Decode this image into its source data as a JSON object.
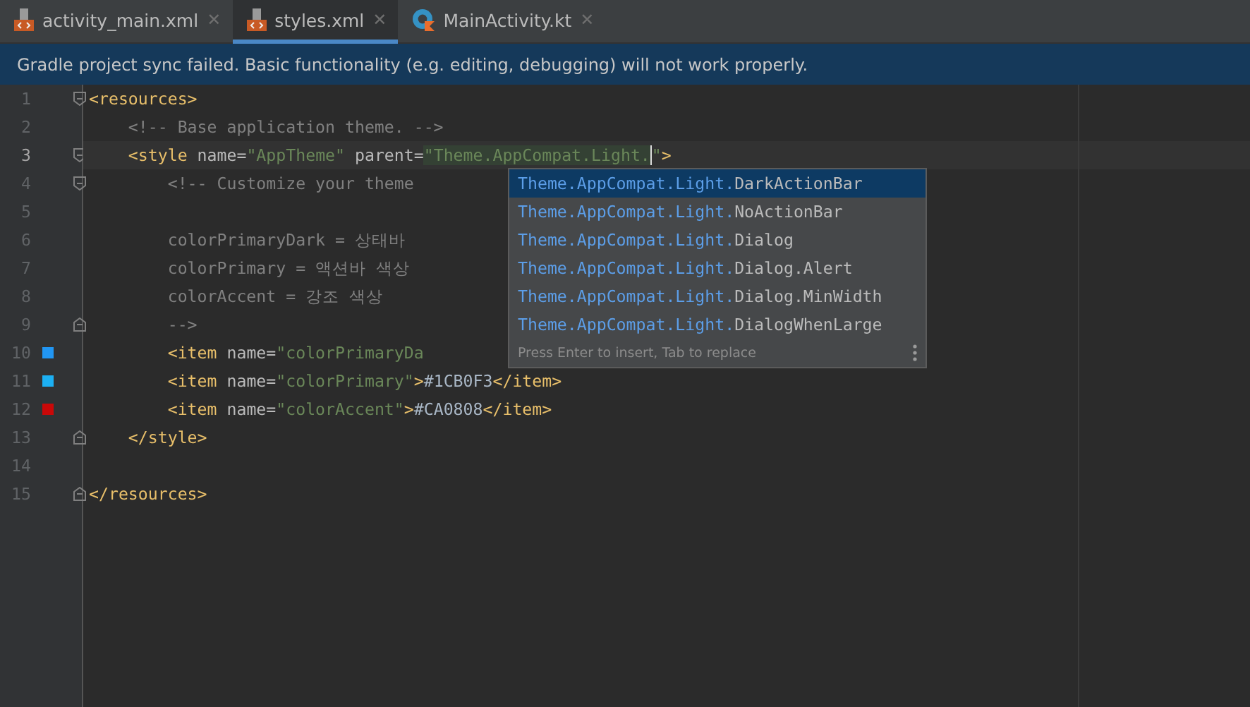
{
  "tabs": [
    {
      "label": "activity_main.xml",
      "kind": "xml",
      "close": "✕",
      "selected": false
    },
    {
      "label": "styles.xml",
      "kind": "xml",
      "close": "✕",
      "selected": true
    },
    {
      "label": "MainActivity.kt",
      "kind": "kotlin",
      "close": "✕",
      "selected": false
    }
  ],
  "banner": "Gradle project sync failed. Basic functionality (e.g. editing, debugging) will not work properly.",
  "lines": [
    {
      "number": "1",
      "kind": "opener",
      "tokens": [
        {
          "kind": "tag",
          "text": "<resources>"
        }
      ]
    },
    {
      "number": "2",
      "kind": "plain",
      "tokens": [
        {
          "kind": "comment",
          "text": "    <!-- Base application theme. -->"
        }
      ]
    },
    {
      "number": "3",
      "kind": "opener",
      "current": true,
      "tokens": [
        {
          "kind": "tag",
          "text": "    <style"
        },
        {
          "kind": "attr",
          "text": " name="
        },
        {
          "kind": "value",
          "text": "\"AppTheme\""
        },
        {
          "kind": "attr",
          "text": " parent="
        },
        {
          "kind": "edit",
          "text": "\"Theme.AppCompat.Light."
        },
        {
          "kind": "value",
          "text": "\""
        },
        {
          "kind": "tag",
          "text": ">"
        }
      ]
    },
    {
      "number": "4",
      "kind": "opener",
      "tokens": [
        {
          "kind": "comment",
          "text": "        <!-- Customize your theme"
        }
      ]
    },
    {
      "number": "5",
      "kind": "plain"
    },
    {
      "number": "6",
      "kind": "plain",
      "tokens": [
        {
          "kind": "comment",
          "text": "        colorPrimaryDark = 상태바"
        }
      ]
    },
    {
      "number": "7",
      "kind": "plain",
      "tokens": [
        {
          "kind": "comment",
          "text": "        colorPrimary = 액션바 색상"
        }
      ]
    },
    {
      "number": "8",
      "kind": "plain",
      "tokens": [
        {
          "kind": "comment",
          "text": "        colorAccent = 강조 색상"
        }
      ]
    },
    {
      "number": "9",
      "kind": "closer",
      "tokens": [
        {
          "kind": "comment",
          "text": "        -->"
        }
      ]
    },
    {
      "number": "10",
      "kind": "plain",
      "color": "#2196f3",
      "tokens": [
        {
          "kind": "tag",
          "text": "        <item"
        },
        {
          "kind": "attr",
          "text": " name="
        },
        {
          "kind": "value",
          "text": "\"colorPrimaryDa"
        }
      ]
    },
    {
      "number": "11",
      "kind": "plain",
      "color": "#1cb0f3",
      "tokens": [
        {
          "kind": "tag",
          "text": "        <item"
        },
        {
          "kind": "attr",
          "text": " name="
        },
        {
          "kind": "value",
          "text": "\"colorPrimary\""
        },
        {
          "kind": "tag",
          "text": ">"
        },
        {
          "kind": "text",
          "text": "#1CB0F3"
        },
        {
          "kind": "tag",
          "text": "</item>"
        }
      ]
    },
    {
      "number": "12",
      "kind": "plain",
      "color": "#ca0808",
      "tokens": [
        {
          "kind": "tag",
          "text": "        <item"
        },
        {
          "kind": "attr",
          "text": " name="
        },
        {
          "kind": "value",
          "text": "\"colorAccent\""
        },
        {
          "kind": "tag",
          "text": ">"
        },
        {
          "kind": "text",
          "text": "#CA0808"
        },
        {
          "kind": "tag",
          "text": "</item>"
        }
      ]
    },
    {
      "number": "13",
      "kind": "closer",
      "tokens": [
        {
          "kind": "tag",
          "text": "    </style>"
        }
      ]
    },
    {
      "number": "14",
      "kind": "plain"
    },
    {
      "number": "15",
      "kind": "closer",
      "tokens": [
        {
          "kind": "tag",
          "text": "</resources>"
        }
      ]
    }
  ],
  "completion": {
    "items": [
      {
        "match": "Theme.AppCompat.Light.",
        "rest": "DarkActionBar",
        "selected": true
      },
      {
        "match": "Theme.AppCompat.Light.",
        "rest": "NoActionBar",
        "selected": false
      },
      {
        "match": "Theme.AppCompat.Light.",
        "rest": "Dialog",
        "selected": false
      },
      {
        "match": "Theme.AppCompat.Light.",
        "rest": "Dialog.Alert",
        "selected": false
      },
      {
        "match": "Theme.AppCompat.Light.",
        "rest": "Dialog.MinWidth",
        "selected": false
      },
      {
        "match": "Theme.AppCompat.Light.",
        "rest": "DialogWhenLarge",
        "selected": false
      }
    ],
    "hint": "Press Enter to insert, Tab to replace"
  }
}
